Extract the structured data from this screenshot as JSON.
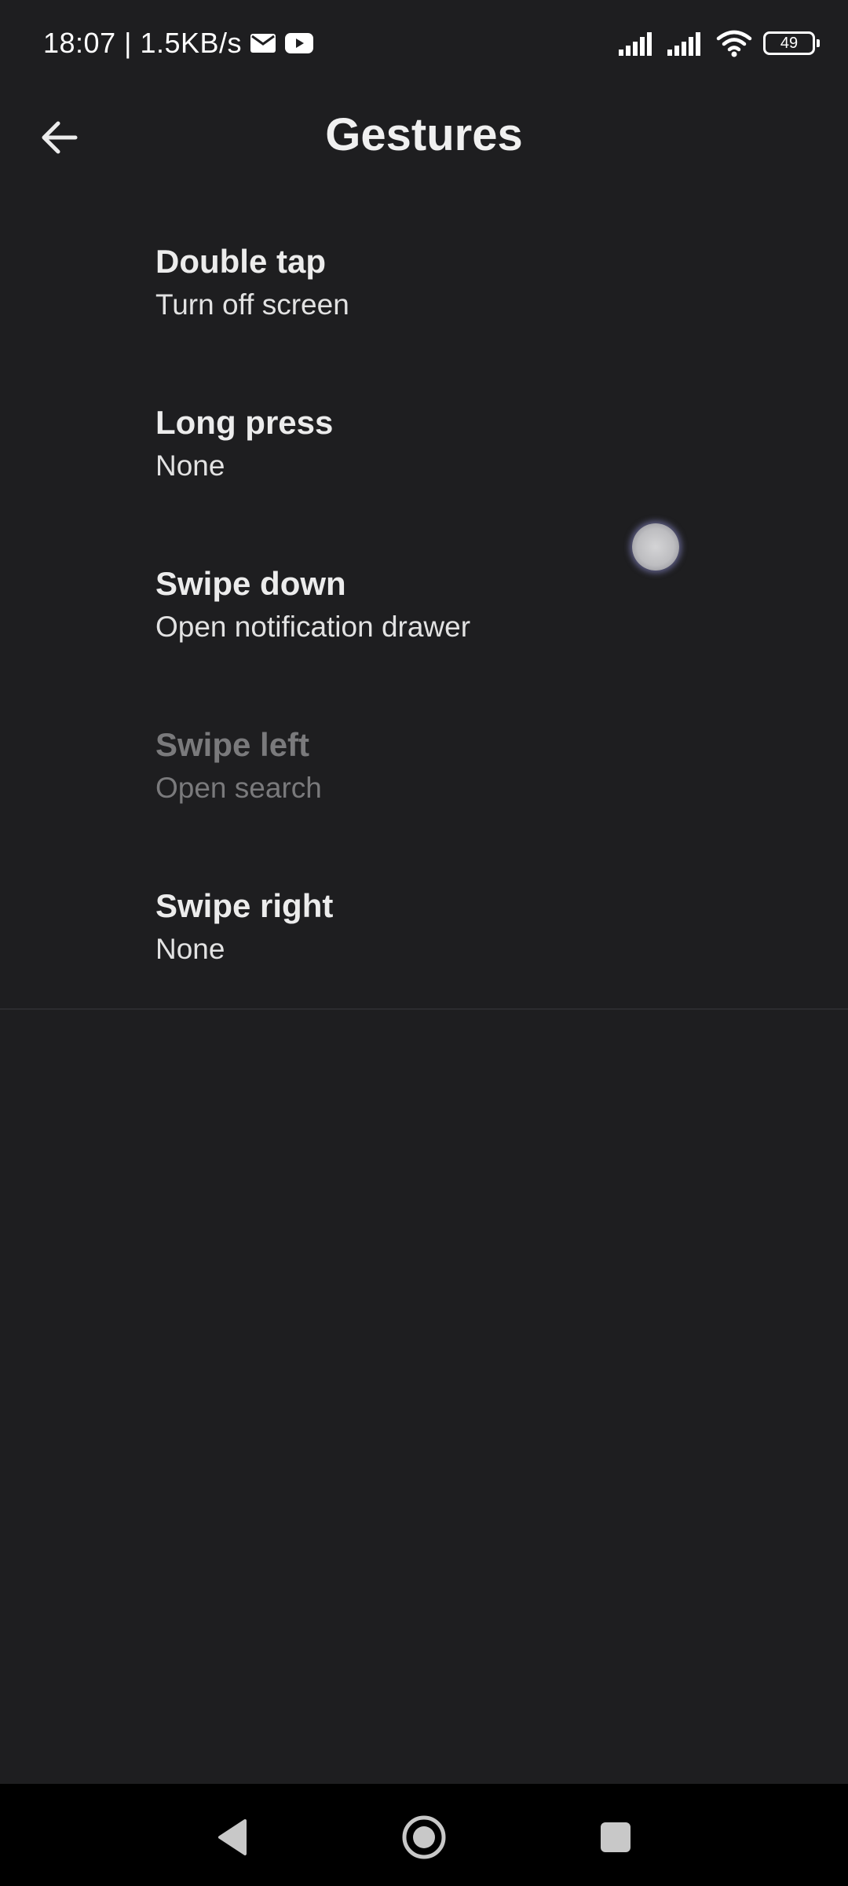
{
  "status_bar": {
    "time_speed": "18:07 | 1.5KB/s",
    "icons": [
      "mail-icon",
      "youtube-icon",
      "signal-icon",
      "signal-icon",
      "wifi-icon",
      "battery-icon"
    ],
    "battery_level": "49"
  },
  "header": {
    "title": "Gestures",
    "back_icon": "arrow-left-icon"
  },
  "gestures": [
    {
      "title": "Double tap",
      "value": "Turn off screen",
      "enabled": true
    },
    {
      "title": "Long press",
      "value": "None",
      "enabled": true
    },
    {
      "title": "Swipe down",
      "value": "Open notification drawer",
      "enabled": true
    },
    {
      "title": "Swipe left",
      "value": "Open search",
      "enabled": false
    },
    {
      "title": "Swipe right",
      "value": "None",
      "enabled": true
    }
  ],
  "nav_bar": {
    "buttons": [
      "back-triangle-icon",
      "home-circle-icon",
      "recents-square-icon"
    ]
  },
  "colors": {
    "background": "#1e1e20",
    "text_primary": "#ececec",
    "text_disabled": "#7a7a7c",
    "nav_background": "#000000"
  }
}
